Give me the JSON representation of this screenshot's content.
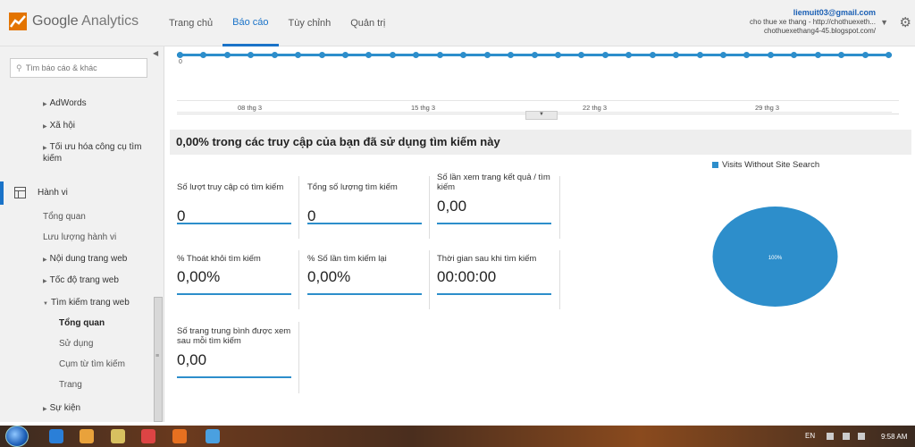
{
  "header": {
    "logo_word1": "Google",
    "logo_word2": "Analytics",
    "tabs": [
      {
        "label": "Trang chủ",
        "active": false
      },
      {
        "label": "Báo cáo",
        "active": true
      },
      {
        "label": "Tùy chỉnh",
        "active": false
      },
      {
        "label": "Quản trị",
        "active": false
      }
    ],
    "account": {
      "email": "liemuit03@gmail.com",
      "property": "cho thue xe thang - http://chothuexeth...",
      "site": "chothuexethang4-45.blogspot.com/"
    }
  },
  "sidebar": {
    "search_placeholder": "Tìm báo cáo & khác",
    "items_top": [
      "AdWords",
      "Xã hội",
      "Tối ưu hóa công cụ tìm kiếm"
    ],
    "section_label": "Hành vi",
    "behavior_items": [
      "Tổng quan",
      "Lưu lượng hành vi"
    ],
    "expandable": [
      "Nội dung trang web",
      "Tốc độ trang web",
      "Tìm kiếm trang web"
    ],
    "site_search_sub": [
      "Tổng quan",
      "Sử dụng",
      "Cụm từ tìm kiếm",
      "Trang"
    ],
    "events_label": "Sự kiện"
  },
  "chart_data": {
    "type": "line",
    "x_tick_labels": [
      "08 thg 3",
      "15 thg 3",
      "22 thg 3",
      "29 thg 3"
    ],
    "y_tick_label": "0",
    "series": [
      {
        "values": [
          0,
          0,
          0,
          0,
          0,
          0,
          0,
          0,
          0,
          0,
          0,
          0,
          0,
          0,
          0,
          0,
          0,
          0,
          0,
          0,
          0,
          0,
          0,
          0,
          0,
          0,
          0,
          0,
          0,
          0,
          0
        ]
      }
    ]
  },
  "summary": "0,00% trong các truy cập của bạn đã sử dụng tìm kiếm này",
  "metrics": [
    {
      "label": "Số lượt truy cập có tìm kiếm",
      "value": "0"
    },
    {
      "label": "Tổng số lượng tìm kiếm",
      "value": "0"
    },
    {
      "label": "Số lần xem trang kết quả / tìm kiếm",
      "value": "0,00"
    },
    {
      "label": "% Thoát khỏi tìm kiếm",
      "value": "0,00%"
    },
    {
      "label": "% Số lần tìm kiếm lại",
      "value": "0,00%"
    },
    {
      "label": "Thời gian sau khi tìm kiếm",
      "value": "00:00:00"
    },
    {
      "label": "Số trang trung bình được xem sau mỗi tìm kiếm",
      "value": "0,00"
    }
  ],
  "pie": {
    "legend": "Visits Without Site Search",
    "slice_label": "100%",
    "slice_value": 100,
    "color": "#2d8ecb"
  },
  "taskbar": {
    "lang": "EN",
    "time": "9:58 AM"
  }
}
